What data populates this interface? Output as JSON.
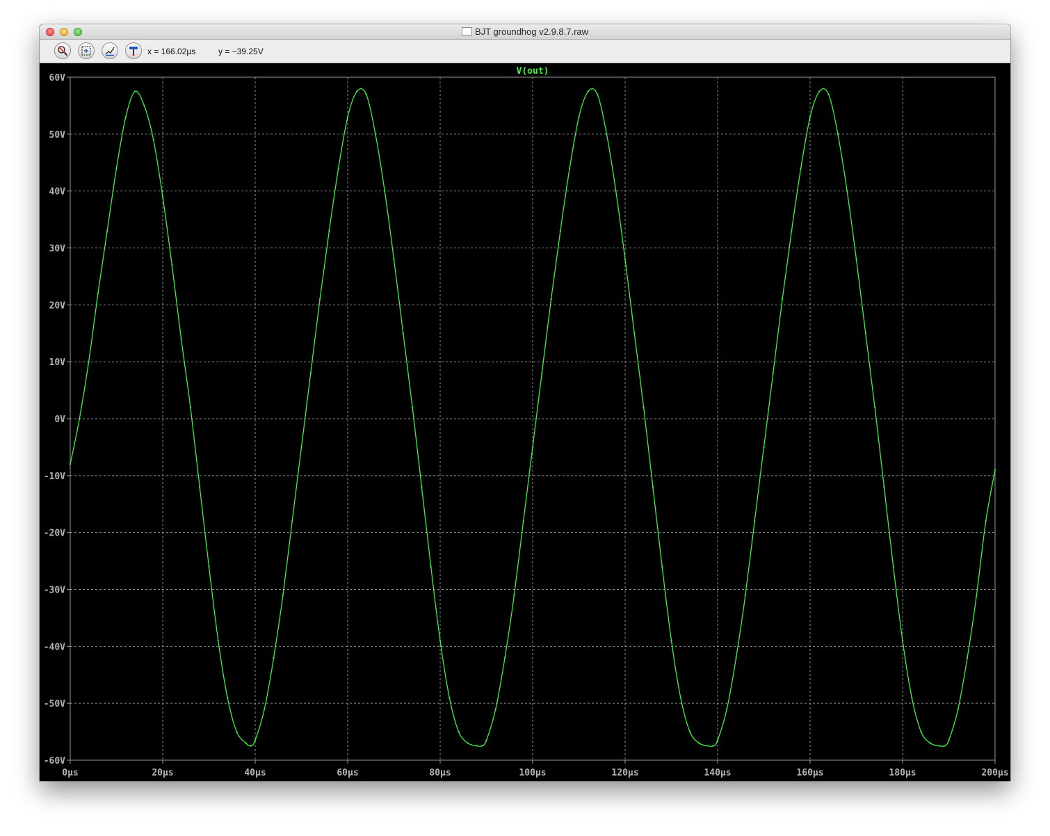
{
  "window": {
    "title": "BJT groundhog v2.9.8.7.raw"
  },
  "toolbar": {
    "buttons": [
      "zoom-cancel-icon",
      "autorange-icon",
      "autorange-y-icon",
      "probe-icon"
    ],
    "cursor_x": "x = 166.02µs",
    "cursor_y": "y = −39.25V"
  },
  "chart_data": {
    "type": "line",
    "title": "",
    "xlabel": "",
    "ylabel": "",
    "xlim": [
      0,
      200
    ],
    "ylim": [
      -60,
      60
    ],
    "x_unit": "µs",
    "y_unit": "V",
    "grid": true,
    "grid_style": "dashed",
    "background": "#000000",
    "series": [
      {
        "name": "V(out)",
        "color": "#3cf23c",
        "x": [
          0,
          2,
          4,
          6,
          8,
          10,
          12,
          14,
          16,
          18,
          20,
          22,
          24,
          26,
          28,
          30,
          32,
          34,
          36,
          38,
          39,
          40,
          42,
          44,
          46,
          48,
          50,
          52,
          54,
          56,
          58,
          60,
          62,
          64,
          66,
          68,
          70,
          72,
          74,
          76,
          78,
          80,
          82,
          84,
          86,
          88,
          89,
          90,
          92,
          94,
          96,
          98,
          100,
          102,
          104,
          106,
          108,
          110,
          112,
          114,
          116,
          118,
          120,
          122,
          124,
          126,
          128,
          130,
          132,
          134,
          136,
          138,
          139,
          140,
          142,
          144,
          146,
          148,
          150,
          152,
          154,
          156,
          158,
          160,
          162,
          164,
          166,
          168,
          170,
          172,
          174,
          176,
          178,
          180,
          182,
          184,
          186,
          188,
          189,
          190,
          192,
          194,
          196,
          198,
          200
        ],
        "y": [
          -8,
          0,
          10,
          22,
          33,
          44,
          53,
          57.5,
          55,
          49,
          39,
          27,
          14,
          2,
          -12,
          -26,
          -39,
          -49,
          -55,
          -57,
          -57.5,
          -56.5,
          -51,
          -42,
          -31,
          -18,
          -5,
          8,
          21,
          33,
          44,
          53,
          57.5,
          57,
          50,
          40,
          28,
          15,
          2,
          -12,
          -26,
          -39,
          -49,
          -55,
          -57,
          -57.5,
          -57.5,
          -56.5,
          -51,
          -42,
          -31,
          -18,
          -5,
          8,
          21,
          33,
          44,
          53,
          57.5,
          57,
          50,
          40,
          28,
          15,
          2,
          -12,
          -26,
          -39,
          -49,
          -55,
          -57,
          -57.5,
          -57.5,
          -56.5,
          -51,
          -42,
          -31,
          -18,
          -5,
          8,
          21,
          33,
          44,
          53,
          57.5,
          57,
          50,
          40,
          28,
          15,
          2,
          -12,
          -26,
          -39,
          -49,
          -55,
          -57,
          -57.5,
          -57.5,
          -56.5,
          -51,
          -42,
          -31,
          -18,
          -9
        ]
      }
    ],
    "x_ticks": [
      {
        "value": 0,
        "label": "0µs"
      },
      {
        "value": 20,
        "label": "20µs"
      },
      {
        "value": 40,
        "label": "40µs"
      },
      {
        "value": 60,
        "label": "60µs"
      },
      {
        "value": 80,
        "label": "80µs"
      },
      {
        "value": 100,
        "label": "100µs"
      },
      {
        "value": 120,
        "label": "120µs"
      },
      {
        "value": 140,
        "label": "140µs"
      },
      {
        "value": 160,
        "label": "160µs"
      },
      {
        "value": 180,
        "label": "180µs"
      },
      {
        "value": 200,
        "label": "200µs"
      }
    ],
    "y_ticks": [
      {
        "value": 60,
        "label": "60V"
      },
      {
        "value": 50,
        "label": "50V"
      },
      {
        "value": 40,
        "label": "40V"
      },
      {
        "value": 30,
        "label": "30V"
      },
      {
        "value": 20,
        "label": "20V"
      },
      {
        "value": 10,
        "label": "10V"
      },
      {
        "value": 0,
        "label": "0V"
      },
      {
        "value": -10,
        "label": "-10V"
      },
      {
        "value": -20,
        "label": "-20V"
      },
      {
        "value": -30,
        "label": "-30V"
      },
      {
        "value": -40,
        "label": "-40V"
      },
      {
        "value": -50,
        "label": "-50V"
      },
      {
        "value": -60,
        "label": "-60V"
      }
    ]
  }
}
